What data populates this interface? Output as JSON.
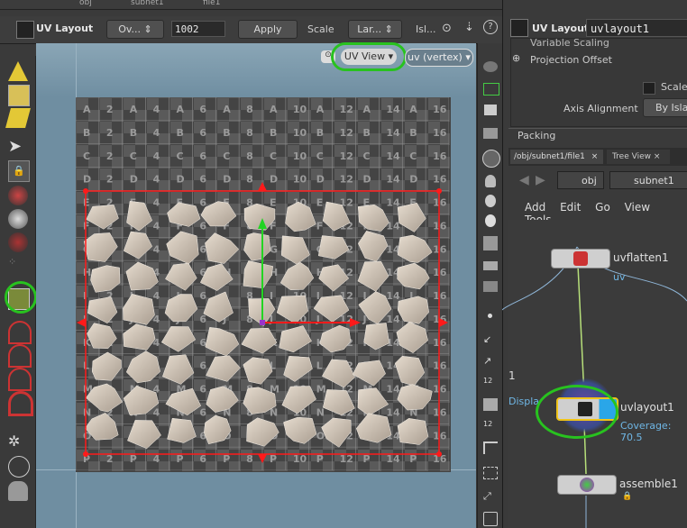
{
  "topbar": {
    "crumbs": [
      "obj",
      "subnet1",
      "file1"
    ]
  },
  "toolbar": {
    "title": "UV Layout",
    "ov_dropdown": "Ov...",
    "iterations": "1002",
    "apply": "Apply",
    "scale_label": "Scale",
    "scale_dropdown": "Lar...",
    "islands_label": "Isl..."
  },
  "viewport": {
    "view_menu": "UV View",
    "attrib_menu": "uv (vertex)",
    "grid_rows": [
      "A",
      "B",
      "C",
      "D",
      "E",
      "F",
      "G",
      "H",
      "I",
      "J",
      "K",
      "L",
      "M",
      "N",
      "O",
      "P"
    ],
    "grid_cols": [
      "2",
      "4",
      "6",
      "8",
      "10",
      "12",
      "14",
      "16"
    ]
  },
  "param_panel": {
    "title": "UV Layout",
    "node_name": "uvlayout1",
    "variable_scaling": "Variable Scaling",
    "projection_offset": "Projection Offset",
    "scale_checkbox": "Scale",
    "axis_alignment_label": "Axis Alignment",
    "axis_alignment_value": "By Islan",
    "packing_tab": "Packing"
  },
  "network_pane": {
    "path_tab": "/obj/subnet1/file1",
    "tree_tab": "Tree View",
    "path_obj": "obj",
    "path_subnet": "subnet1",
    "menu": [
      "Add",
      "Edit",
      "Go",
      "View",
      "Tools"
    ],
    "nodes": [
      {
        "name": "uvflatten1",
        "sub": "uv"
      },
      {
        "name": "uvlayout1",
        "sub": "Coverage: 70.5"
      },
      {
        "name": "assemble1",
        "sub": ""
      }
    ],
    "side_num": "1",
    "side_display": "Displa"
  },
  "colors": {
    "selection_ring": "#28c21f",
    "uv_bounds": "#ff1a1a",
    "node_selected": "#f0c419",
    "node_display": "#2aa6e8"
  }
}
